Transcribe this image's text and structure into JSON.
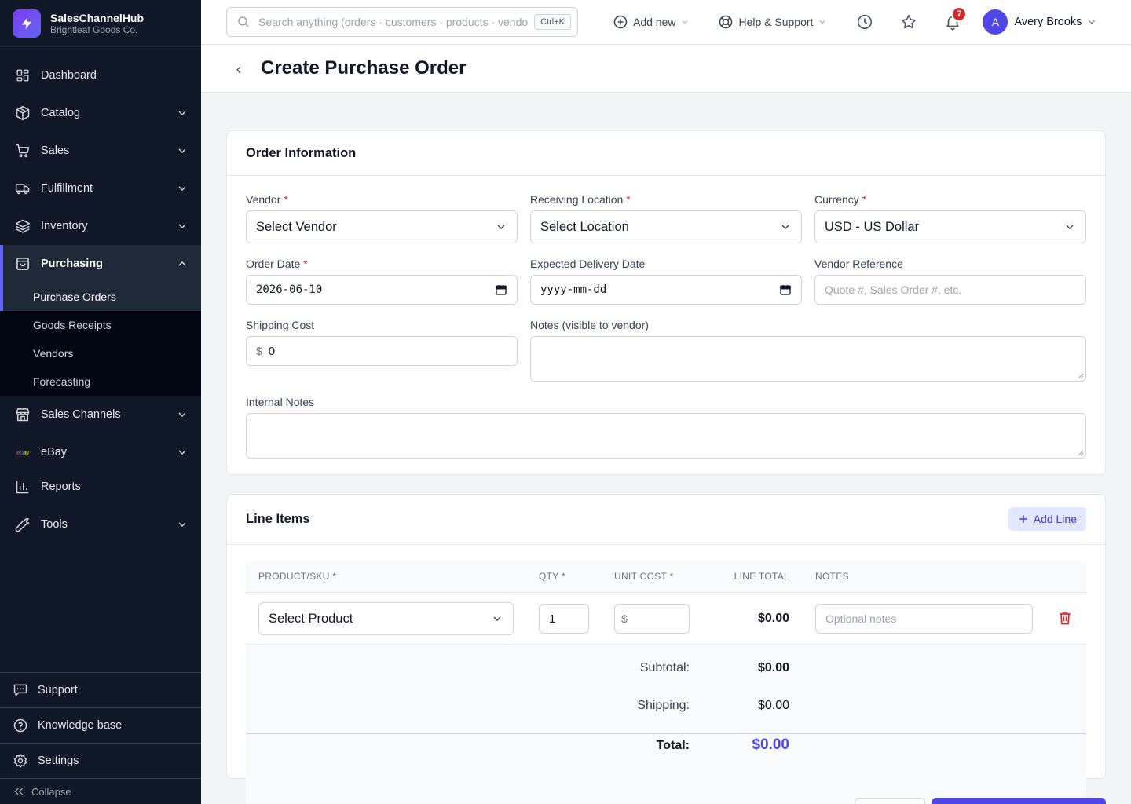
{
  "brand": {
    "name": "SalesChannelHub",
    "company": "Brightleaf Goods Co."
  },
  "sidebar": {
    "items": [
      {
        "label": "Dashboard"
      },
      {
        "label": "Catalog"
      },
      {
        "label": "Sales"
      },
      {
        "label": "Fulfillment"
      },
      {
        "label": "Inventory"
      },
      {
        "label": "Purchasing"
      },
      {
        "label": "Sales Channels"
      },
      {
        "label": "eBay"
      },
      {
        "label": "Reports"
      },
      {
        "label": "Tools"
      }
    ],
    "purchasing_sub": [
      "Purchase Orders",
      "Goods Receipts",
      "Vendors",
      "Forecasting"
    ],
    "ebay_logo": {
      "e": "e",
      "b": "b",
      "a": "a",
      "y": "y"
    },
    "bottom": {
      "support": "Support",
      "knowledge": "Knowledge base",
      "settings": "Settings",
      "collapse": "Collapse"
    }
  },
  "topbar": {
    "search_placeholder": "Search anything (orders · customers · products · vendors)",
    "shortcut": "Ctrl+K",
    "add_new": "Add new",
    "help": "Help & Support",
    "notification_count": "7",
    "user_initial": "A",
    "user_name": "Avery Brooks"
  },
  "page": {
    "title": "Create Purchase Order"
  },
  "order_info": {
    "title": "Order Information",
    "vendor_label": "Vendor",
    "vendor_value": "Select Vendor",
    "location_label": "Receiving Location",
    "location_value": "Select Location",
    "currency_label": "Currency",
    "currency_value": "USD - US Dollar",
    "order_date_label": "Order Date",
    "order_date_value": "2026-06-10",
    "expected_label": "Expected Delivery Date",
    "expected_placeholder": "yyyy-mm-dd",
    "vendor_ref_label": "Vendor Reference",
    "vendor_ref_placeholder": "Quote #, Sales Order #, etc.",
    "shipping_label": "Shipping Cost",
    "shipping_prefix": "$",
    "shipping_value": "0",
    "notes_label": "Notes (visible to vendor)",
    "internal_label": "Internal Notes",
    "required_mark": "*"
  },
  "line_items": {
    "title": "Line Items",
    "add_line": "Add Line",
    "columns": [
      "PRODUCT/SKU *",
      "QTY *",
      "UNIT COST *",
      "LINE TOTAL",
      "NOTES"
    ],
    "row": {
      "product": "Select Product",
      "qty": "1",
      "unit_prefix": "$",
      "line_total": "$0.00",
      "notes_placeholder": "Optional notes"
    },
    "subtotal_label": "Subtotal:",
    "subtotal_value": "$0.00",
    "shipping_label": "Shipping:",
    "shipping_value": "$0.00",
    "total_label": "Total:",
    "total_value": "$0.00"
  },
  "colors": {
    "accent": "#4f46e5",
    "sidebar_bg": "#111827",
    "danger": "#dc2626"
  }
}
